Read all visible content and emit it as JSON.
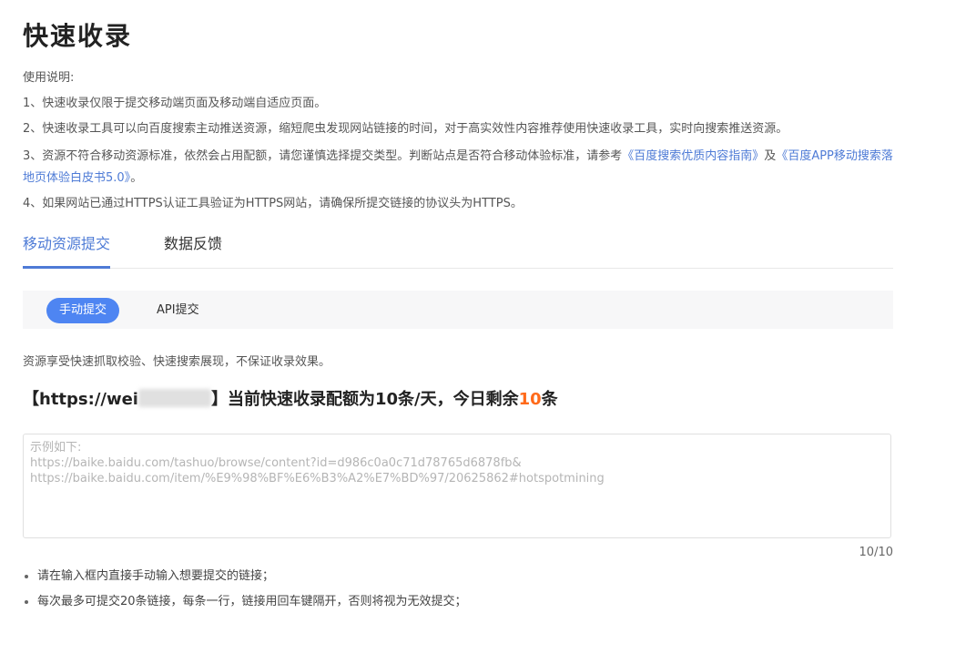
{
  "page": {
    "title": "快速收录"
  },
  "usage": {
    "heading": "使用说明:",
    "item1": "1、快速收录仅限于提交移动端页面及移动端自适应页面。",
    "item2": "2、快速收录工具可以向百度搜索主动推送资源，缩短爬虫发现网站链接的时间，对于高实效性内容推荐使用快速收录工具，实时向搜索推送资源。",
    "item3_prefix": "3、资源不符合移动资源标准，依然会占用配额，请您谨慎选择提交类型。判断站点是否符合移动体验标准，请参考",
    "item3_link1": "《百度搜索优质内容指南》",
    "item3_mid": "及",
    "item3_link2": "《百度APP移动搜索落地页体验白皮书5.0》",
    "item3_suffix": "。",
    "item4": "4、如果网站已通过HTTPS认证工具验证为HTTPS网站，请确保所提交链接的协议头为HTTPS。"
  },
  "tabs": {
    "mobile": "移动资源提交",
    "feedback": "数据反馈"
  },
  "subtabs": {
    "manual": "手动提交",
    "api": "API提交"
  },
  "note": "资源享受快速抓取校验、快速搜索展现，不保证收录效果。",
  "quota": {
    "site_prefix": "【https://wei",
    "site_suffix": "】",
    "text": "当前快速收录配额为10条/天，今日剩余",
    "remaining": "10",
    "unit": "条"
  },
  "textarea": {
    "line1": "示例如下:",
    "line2": "https://baike.baidu.com/tashuo/browse/content?id=d986c0a0c71d78765d6878fb&",
    "line3": "https://baike.baidu.com/item/%E9%98%BF%E6%B3%A2%E7%BD%97/20625862#hotspotmining"
  },
  "counter": "10/10",
  "tips": {
    "tip1": "请在输入框内直接手动输入想要提交的链接；",
    "tip2": "每次最多可提交20条链接，每条一行，链接用回车键隔开，否则将视为无效提交；"
  },
  "colors": {
    "accent": "#4e85f2",
    "link": "#4e7bd6",
    "highlight": "#ff6a1a"
  }
}
